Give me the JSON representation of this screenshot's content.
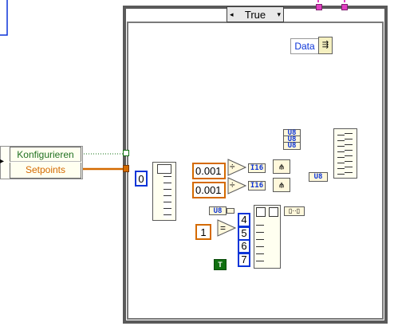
{
  "case_structure": {
    "selector_value": "True",
    "selector_left_arrow": "◂",
    "selector_right_arrow": "▾"
  },
  "cluster_labels": {
    "konfigurieren": "Konfigurieren",
    "setpoints": "Setpoints"
  },
  "data_label": "Data",
  "constants": {
    "zero": "0",
    "delay_top": "0.001",
    "delay_bottom": "0.001",
    "one": "1",
    "four": "4",
    "five": "5",
    "six": "6",
    "seven": "7",
    "true_const": "T"
  },
  "conversions": {
    "u8_a": "U8",
    "u8_b": "U8",
    "u8_c": "U8",
    "i16_a": "I16",
    "i16_b": "I16",
    "u8_d": "U8",
    "u8_e": "U8"
  },
  "operators": {
    "divide_top": "÷",
    "divide_bottom": "÷",
    "equal": "="
  },
  "colors": {
    "wire_orange": "#d46a00",
    "wire_blue": "#0b34d8",
    "wire_pink": "#e040c0",
    "wire_green": "#107010",
    "case_border": "#5a5a5a",
    "label_text_green": "#207020",
    "label_text_orange": "#d46a00"
  }
}
